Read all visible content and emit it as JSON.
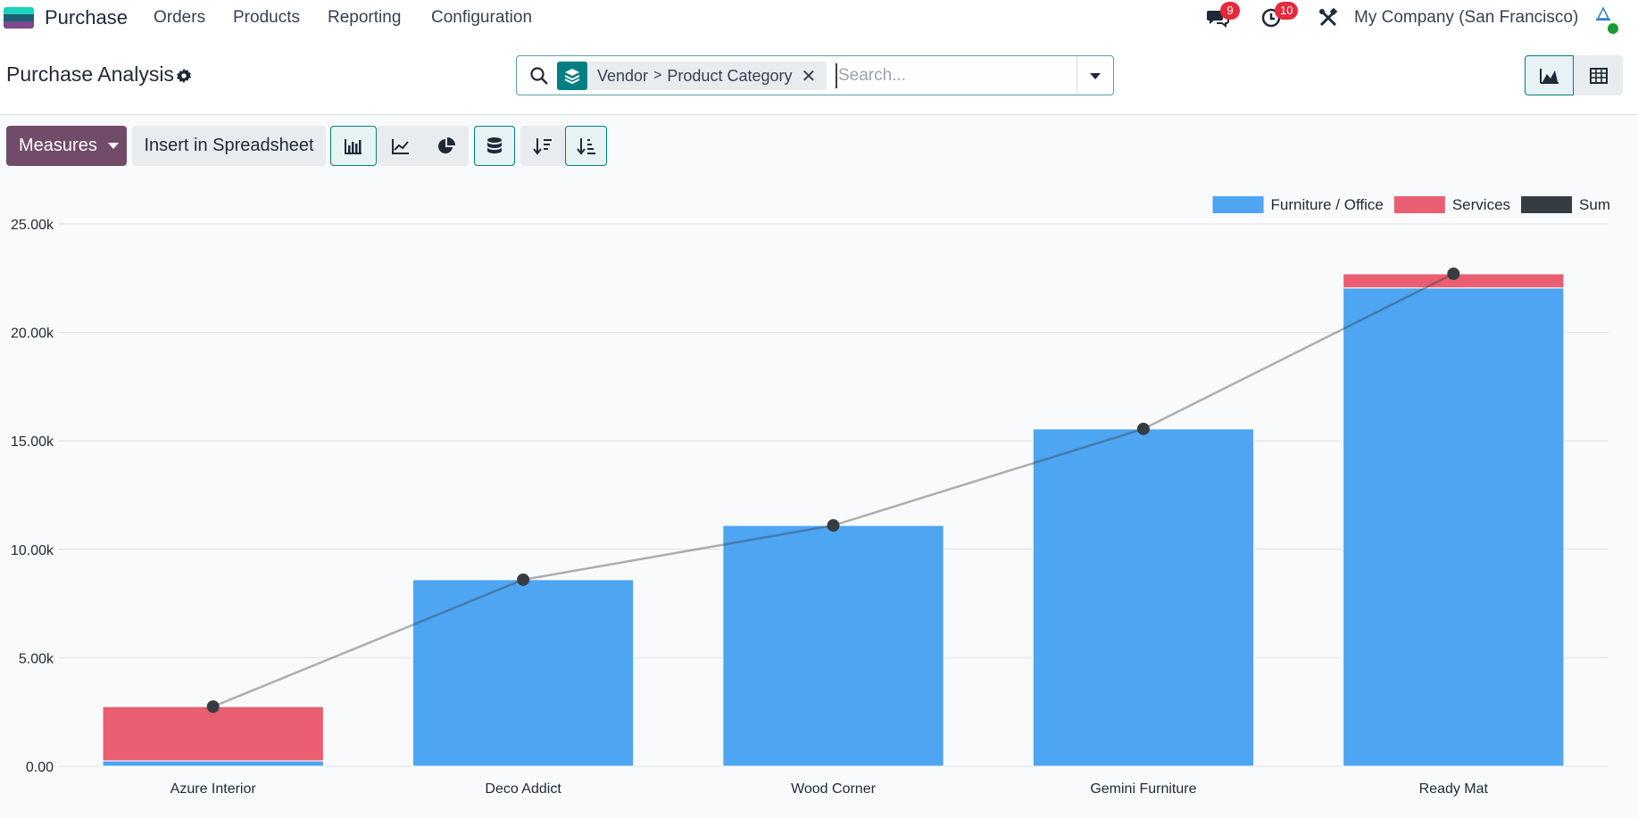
{
  "navbar": {
    "app_name": "Purchase",
    "menu": [
      "Orders",
      "Products",
      "Reporting",
      "Configuration"
    ],
    "messages_badge": "9",
    "activities_badge": "10",
    "company": "My Company (San Francisco)"
  },
  "control_panel": {
    "title": "Purchase Analysis",
    "facet": {
      "parts": [
        "Vendor",
        "Product Category"
      ],
      "separator": ">"
    },
    "search_placeholder": "Search..."
  },
  "toolbar": {
    "measures_label": "Measures",
    "insert_label": "Insert in Spreadsheet"
  },
  "colors": {
    "accent": "#017e84",
    "brand": "#714b67",
    "furniture": "#4ea5f2",
    "services": "#ea5e71",
    "sum": "#373c42"
  },
  "icons": [
    "messages-icon",
    "activity-clock-icon",
    "debug-tools-icon",
    "bar-chart-icon",
    "line-chart-icon",
    "pie-chart-icon",
    "stacked-icon",
    "sort-descending-icon",
    "sort-ascending-icon",
    "graph-view-icon",
    "pivot-view-icon"
  ],
  "chart_data": {
    "type": "bar",
    "stacked": true,
    "categories": [
      "Azure Interior",
      "Deco Addict",
      "Wood Corner",
      "Gemini Furniture",
      "Ready Mat"
    ],
    "series": [
      {
        "name": "Furniture / Office",
        "values": [
          250,
          8600,
          11100,
          15550,
          22050
        ]
      },
      {
        "name": "Services",
        "values": [
          2500,
          0,
          0,
          0,
          650
        ]
      },
      {
        "name": "Sum",
        "type": "line",
        "values": [
          2750,
          8600,
          11100,
          15550,
          22700
        ]
      }
    ],
    "ylim": [
      0,
      25000
    ],
    "yticks": [
      "0.00",
      "5.00k",
      "10.00k",
      "15.00k",
      "20.00k",
      "25.00k"
    ],
    "ytick_values": [
      0,
      5000,
      10000,
      15000,
      20000,
      25000
    ],
    "legend_position": "top-right",
    "grid": true
  }
}
